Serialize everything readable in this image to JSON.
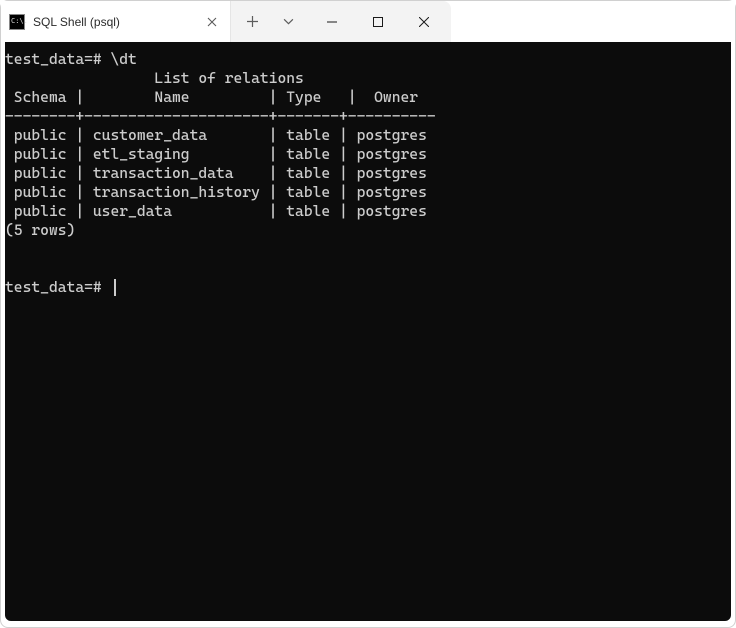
{
  "window": {
    "tab_title": "SQL Shell (psql)",
    "tab_icon_text": "C:\\."
  },
  "terminal": {
    "prompt_db": "test_data",
    "prompt_suffix": "=#",
    "command": "\\dt",
    "table_title": "List of relations",
    "columns": [
      "Schema",
      "Name",
      "Type",
      "Owner"
    ],
    "rows": [
      {
        "schema": "public",
        "name": "customer_data",
        "type": "table",
        "owner": "postgres"
      },
      {
        "schema": "public",
        "name": "etl_staging",
        "type": "table",
        "owner": "postgres"
      },
      {
        "schema": "public",
        "name": "transaction_data",
        "type": "table",
        "owner": "postgres"
      },
      {
        "schema": "public",
        "name": "transaction_history",
        "type": "table",
        "owner": "postgres"
      },
      {
        "schema": "public",
        "name": "user_data",
        "type": "table",
        "owner": "postgres"
      }
    ],
    "row_count_text": "(5 rows)"
  }
}
